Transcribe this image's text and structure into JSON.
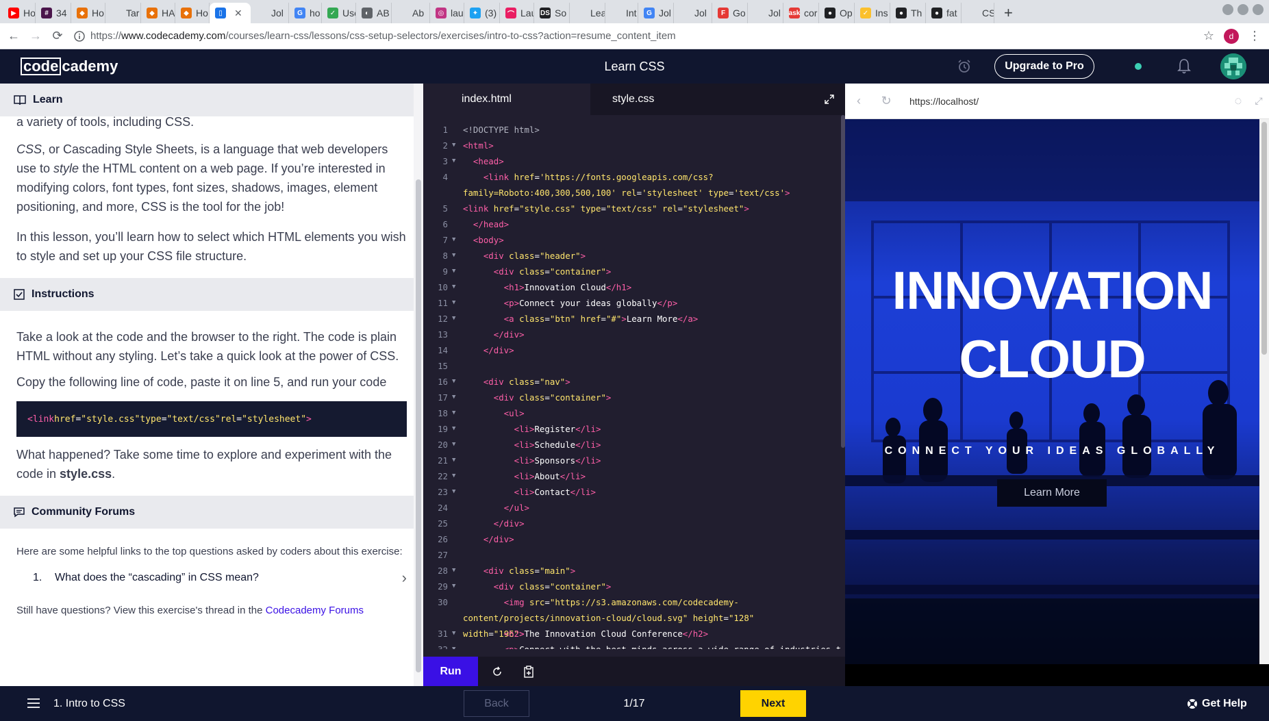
{
  "browser": {
    "tabs": [
      {
        "title": "Ho",
        "color": "#ff0000",
        "glyph": "▶"
      },
      {
        "title": "34",
        "color": "#4a154b",
        "glyph": "#"
      },
      {
        "title": "Ho",
        "color": "#e8710a",
        "glyph": "◆"
      },
      {
        "title": "Tar",
        "color": "#dee1e6",
        "glyph": ""
      },
      {
        "title": "HA",
        "color": "#e8710a",
        "glyph": "◆"
      },
      {
        "title": "Ho",
        "color": "#e8710a",
        "glyph": "◆"
      },
      {
        "title": "",
        "color": "#1a73e8",
        "glyph": "▯",
        "active": true
      },
      {
        "title": "Jol",
        "color": "#dee1e6",
        "glyph": ""
      },
      {
        "title": "ho",
        "color": "#4285f4",
        "glyph": "G"
      },
      {
        "title": "Use",
        "color": "#34a853",
        "glyph": "✓"
      },
      {
        "title": "AB",
        "color": "#5f6368",
        "glyph": "◐"
      },
      {
        "title": "Ab",
        "color": "#dee1e6",
        "glyph": ""
      },
      {
        "title": "lau",
        "color": "#c13584",
        "glyph": "◎"
      },
      {
        "title": "(3)",
        "color": "#1da1f2",
        "glyph": "✦"
      },
      {
        "title": "Lau",
        "color": "#e91e63",
        "glyph": "⌒"
      },
      {
        "title": "So",
        "color": "#202124",
        "glyph": "DS"
      },
      {
        "title": "Lea",
        "color": "#dee1e6",
        "glyph": ""
      },
      {
        "title": "Int",
        "color": "#dee1e6",
        "glyph": ""
      },
      {
        "title": "Jol",
        "color": "#4285f4",
        "glyph": "G"
      },
      {
        "title": "Jol",
        "color": "#dee1e6",
        "glyph": ""
      },
      {
        "title": "Go",
        "color": "#e53935",
        "glyph": "F"
      },
      {
        "title": "Jol",
        "color": "#dee1e6",
        "glyph": ""
      },
      {
        "title": "cor",
        "color": "#e53935",
        "glyph": "ask"
      },
      {
        "title": "Op",
        "color": "#202124",
        "glyph": "●"
      },
      {
        "title": "Ins",
        "color": "#fbc02d",
        "glyph": "✓"
      },
      {
        "title": "Th",
        "color": "#202124",
        "glyph": "●"
      },
      {
        "title": "fat",
        "color": "#202124",
        "glyph": "●"
      },
      {
        "title": "CS",
        "color": "#dee1e6",
        "glyph": ""
      }
    ],
    "url_scheme": "https://",
    "url_host": "www.codecademy.com",
    "url_path": "/courses/learn-css/lessons/css-setup-selectors/exercises/intro-to-css?action=resume_content_item",
    "profile_initial": "d"
  },
  "header": {
    "logo_box": "code",
    "logo_rest": "cademy",
    "course_title": "Learn CSS",
    "upgrade_label": "Upgrade to Pro"
  },
  "learn": {
    "learn_heading": "Learn",
    "intro_fragment": "a variety of tools, including CSS.",
    "p1_a": "CSS",
    "p1_b": ", or Cascading Style Sheets, is a language that web developers use to ",
    "p1_c": "style",
    "p1_d": " the HTML content on a web page. If you’re interested in modifying colors, font types, font sizes, shadows, images, element positioning, and more, CSS is the tool for the job!",
    "p2": "In this lesson, you’ll learn how to select which HTML elements you wish to style and set up your CSS file structure.",
    "instructions_heading": "Instructions",
    "i1": "Take a look at the code and the browser to the right. The code is plain HTML without any styling. Let’s take a quick look at the power of CSS.",
    "i2": "Copy the following line of code, paste it on line 5, and run your code",
    "snippet": {
      "open": "<link",
      "a1": " href",
      "v1": "\"style.css\"",
      "a2": " type",
      "v2": "\"text/css\"",
      "a3": " rel",
      "v3": "\"stylesheet\"",
      "close": ">"
    },
    "i3_a": "What happened? Take some time to explore and experiment with the code in ",
    "i3_b": "style.css",
    "i3_c": ".",
    "forums_heading": "Community Forums",
    "forums_intro": "Here are some helpful links to the top questions asked by coders about this exercise:",
    "forum_items": [
      {
        "num": "1.",
        "text": "What does the “cascading” in CSS mean?"
      }
    ],
    "still_a": "Still have questions? View this exercise's thread in the ",
    "still_link": "Codecademy Forums"
  },
  "editor": {
    "tabs": [
      "index.html",
      "style.css"
    ],
    "run_label": "Run",
    "lines": [
      {
        "n": "1",
        "fold": false,
        "html": "<span class='t-muted'>&lt;!DOCTYPE html&gt;</span>"
      },
      {
        "n": "2",
        "fold": true,
        "html": "<span class='t-tag'>&lt;html&gt;</span>"
      },
      {
        "n": "3",
        "fold": true,
        "html": "  <span class='t-tag'>&lt;head&gt;</span>"
      },
      {
        "n": "4",
        "fold": false,
        "wrap": true,
        "html": "    <span class='t-tag'>&lt;link</span> <span class='t-attr'>href</span>=<span class='t-str'>'https://fonts.googleapis.com/css?family=Roboto:400,300,500,100'</span> <span class='t-attr'>rel</span>=<span class='t-str'>'stylesheet'</span> <span class='t-attr'>type</span>=<span class='t-str'>'text/css'</span><span class='t-tag'>&gt;</span>"
      },
      {
        "n": "5",
        "fold": false,
        "html": "<span class='t-tag'>&lt;link</span> <span class='t-attr'>href</span>=<span class='t-str'>\"style.css\"</span> <span class='t-attr'>type</span>=<span class='t-str'>\"text/css\"</span> <span class='t-attr'>rel</span>=<span class='t-str'>\"stylesheet\"</span><span class='t-tag'>&gt;</span>"
      },
      {
        "n": "6",
        "fold": false,
        "html": "  <span class='t-tag'>&lt;/head&gt;</span>"
      },
      {
        "n": "7",
        "fold": true,
        "html": "  <span class='t-tag'>&lt;body&gt;</span>"
      },
      {
        "n": "8",
        "fold": true,
        "html": "    <span class='t-tag'>&lt;div</span> <span class='t-attr'>class</span>=<span class='t-str'>\"header\"</span><span class='t-tag'>&gt;</span>"
      },
      {
        "n": "9",
        "fold": true,
        "html": "      <span class='t-tag'>&lt;div</span> <span class='t-attr'>class</span>=<span class='t-str'>\"container\"</span><span class='t-tag'>&gt;</span>"
      },
      {
        "n": "10",
        "fold": true,
        "html": "        <span class='t-tag'>&lt;h1&gt;</span>Innovation Cloud<span class='t-tag'>&lt;/h1&gt;</span>"
      },
      {
        "n": "11",
        "fold": true,
        "html": "        <span class='t-tag'>&lt;p&gt;</span>Connect your ideas globally<span class='t-tag'>&lt;/p&gt;</span>"
      },
      {
        "n": "12",
        "fold": true,
        "html": "        <span class='t-tag'>&lt;a</span> <span class='t-attr'>class</span>=<span class='t-str'>\"btn\"</span> <span class='t-attr'>href</span>=<span class='t-str'>\"#\"</span><span class='t-tag'>&gt;</span>Learn More<span class='t-tag'>&lt;/a&gt;</span>"
      },
      {
        "n": "13",
        "fold": false,
        "html": "      <span class='t-tag'>&lt;/div&gt;</span>"
      },
      {
        "n": "14",
        "fold": false,
        "html": "    <span class='t-tag'>&lt;/div&gt;</span>"
      },
      {
        "n": "15",
        "fold": false,
        "html": ""
      },
      {
        "n": "16",
        "fold": true,
        "html": "    <span class='t-tag'>&lt;div</span> <span class='t-attr'>class</span>=<span class='t-str'>\"nav\"</span><span class='t-tag'>&gt;</span>"
      },
      {
        "n": "17",
        "fold": true,
        "html": "      <span class='t-tag'>&lt;div</span> <span class='t-attr'>class</span>=<span class='t-str'>\"container\"</span><span class='t-tag'>&gt;</span>"
      },
      {
        "n": "18",
        "fold": true,
        "html": "        <span class='t-tag'>&lt;ul&gt;</span>"
      },
      {
        "n": "19",
        "fold": true,
        "html": "          <span class='t-tag'>&lt;li&gt;</span>Register<span class='t-tag'>&lt;/li&gt;</span>"
      },
      {
        "n": "20",
        "fold": true,
        "html": "          <span class='t-tag'>&lt;li&gt;</span>Schedule<span class='t-tag'>&lt;/li&gt;</span>"
      },
      {
        "n": "21",
        "fold": true,
        "html": "          <span class='t-tag'>&lt;li&gt;</span>Sponsors<span class='t-tag'>&lt;/li&gt;</span>"
      },
      {
        "n": "22",
        "fold": true,
        "html": "          <span class='t-tag'>&lt;li&gt;</span>About<span class='t-tag'>&lt;/li&gt;</span>"
      },
      {
        "n": "23",
        "fold": true,
        "html": "          <span class='t-tag'>&lt;li&gt;</span>Contact<span class='t-tag'>&lt;/li&gt;</span>"
      },
      {
        "n": "24",
        "fold": false,
        "html": "        <span class='t-tag'>&lt;/ul&gt;</span>"
      },
      {
        "n": "25",
        "fold": false,
        "html": "      <span class='t-tag'>&lt;/div&gt;</span>"
      },
      {
        "n": "26",
        "fold": false,
        "html": "    <span class='t-tag'>&lt;/div&gt;</span>"
      },
      {
        "n": "27",
        "fold": false,
        "html": ""
      },
      {
        "n": "28",
        "fold": true,
        "html": "    <span class='t-tag'>&lt;div</span> <span class='t-attr'>class</span>=<span class='t-str'>\"main\"</span><span class='t-tag'>&gt;</span>"
      },
      {
        "n": "29",
        "fold": true,
        "html": "      <span class='t-tag'>&lt;div</span> <span class='t-attr'>class</span>=<span class='t-str'>\"container\"</span><span class='t-tag'>&gt;</span>"
      },
      {
        "n": "30",
        "fold": false,
        "wrap": true,
        "html": "        <span class='t-tag'>&lt;img</span> <span class='t-attr'>src</span>=<span class='t-str'>\"https://s3.amazonaws.com/codecademy-content/projects/innovation-cloud/cloud.svg\"</span> <span class='t-attr'>height</span>=<span class='t-str'>\"128\"</span> <span class='t-attr'>width</span>=<span class='t-str'>\"196\"</span><span class='t-tag'>&gt;</span>"
      },
      {
        "n": "31",
        "fold": true,
        "html": "        <span class='t-tag'>&lt;h2&gt;</span>The Innovation Cloud Conference<span class='t-tag'>&lt;/h2&gt;</span>"
      },
      {
        "n": "32",
        "fold": true,
        "html": "        <span class='t-tag'>&lt;p&gt;</span>Connect with the best minds across a wide range of industries to"
      }
    ]
  },
  "preview": {
    "url": "https://localhost/",
    "hero_title_1": "INNOVATION",
    "hero_title_2": "CLOUD",
    "hero_subtitle": "CONNECT YOUR IDEAS GLOBALLY",
    "hero_button": "Learn More"
  },
  "footer": {
    "lesson": "1. Intro to CSS",
    "back_label": "Back",
    "progress": "1/17",
    "next_label": "Next",
    "help_label": "Get Help"
  }
}
